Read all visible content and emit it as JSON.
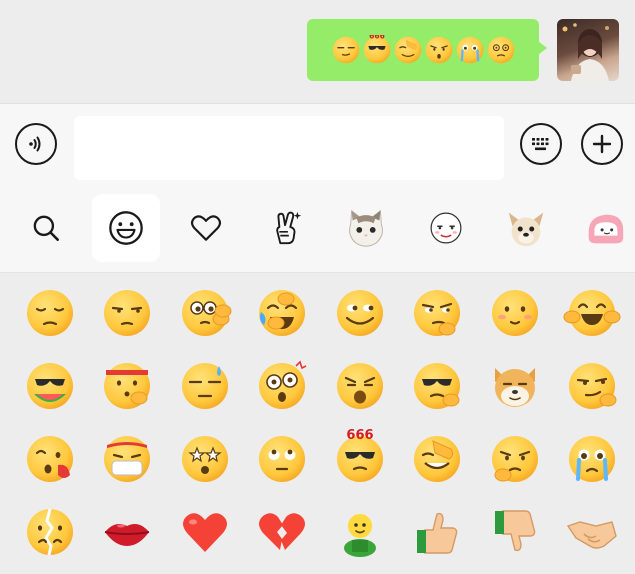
{
  "chat": {
    "sent_message": {
      "emojis": [
        "smirk-face",
        "666-face",
        "facepalm-face",
        "shocked-face",
        "crying-face",
        "dizzy-face"
      ]
    }
  },
  "input_bar": {
    "voice_icon": "voice-icon",
    "message_value": "",
    "keyboard_icon": "keyboard-icon",
    "more_icon": "plus-icon"
  },
  "sticker_tabs": [
    "search-icon",
    "smiley-icon",
    "heart-icon",
    "peace-hand-icon",
    "cat-sticker-icon",
    "face-sticker-icon",
    "dog-sticker-icon",
    "pink-sticker-icon"
  ],
  "active_tab": "smiley-icon",
  "emoji_grid": {
    "columns": 8,
    "rows": [
      [
        "pensive",
        "unamused",
        "wave",
        "laugh-cry",
        "grin-sideeye",
        "thinking-sly",
        "blush",
        "hands-laugh"
      ],
      [
        "watermelon-eat",
        "fighting",
        "sweat",
        "shock-glasses",
        "open-mouth-frown",
        "peek-glasses",
        "doge",
        "smirk-hand"
      ],
      [
        "silly-kiss",
        "mask-sick",
        "star-eyes",
        "eye-roll",
        "666",
        "facepalm",
        "upset-sweat",
        "crying"
      ],
      [
        "broken-face",
        "lips",
        "red-heart",
        "broken-heart",
        "green-figure",
        "thumbs-up",
        "thumbs-down",
        "handshake"
      ]
    ]
  },
  "colors": {
    "bubble": "#95ec69",
    "face": "#ffc83d",
    "face_shade": "#f5a623",
    "heart": "#f44336",
    "lips": "#d01b2a"
  }
}
